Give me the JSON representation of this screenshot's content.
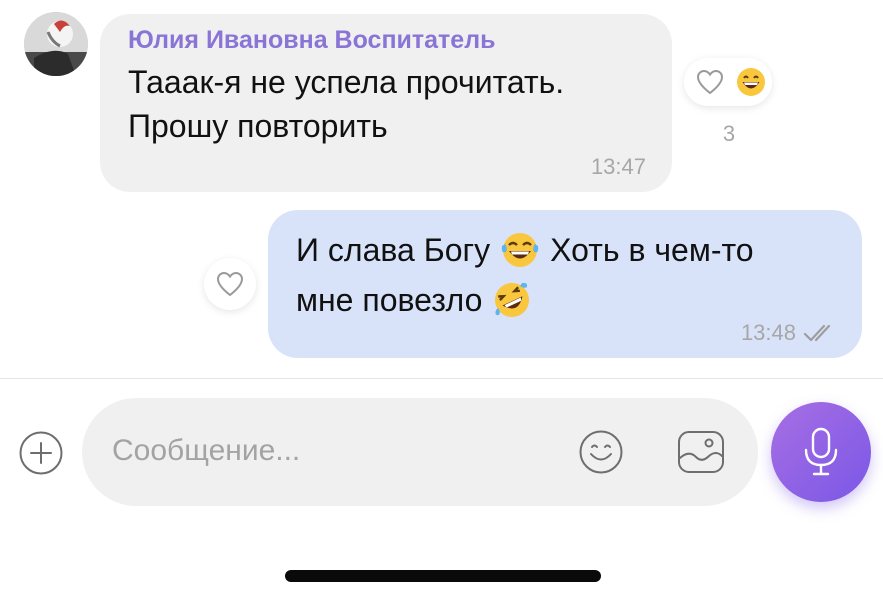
{
  "chat": {
    "incoming": {
      "sender": "Юлия Ивановна Воспитатель",
      "line1": "Тааак-я не успела прочитать.",
      "line2": "Прошу повторить",
      "time": "13:47",
      "reaction": {
        "icons": [
          "heart-outline-icon",
          "grinning-face-emoji"
        ],
        "count": "3"
      }
    },
    "outgoing": {
      "line1_part1": "И слава Богу",
      "line1_emoji": "face-with-tears-of-joy-emoji",
      "line1_part2": "Хоть в чем-то",
      "line2_text": "мне повезло",
      "line2_emoji": "rolling-on-floor-laughing-emoji",
      "time": "13:48",
      "status_icon": "double-check-icon"
    }
  },
  "composer": {
    "placeholder": "Сообщение...",
    "icons": [
      "plus-icon",
      "emoji-face-icon",
      "gallery-icon",
      "microphone-icon"
    ]
  },
  "colors": {
    "accent": "#7a58e6",
    "sender_name": "#8a74d6",
    "incoming_bubble": "#f0f0f0",
    "outgoing_bubble": "#d8e3fa",
    "timestamp": "#a7a7a7"
  }
}
